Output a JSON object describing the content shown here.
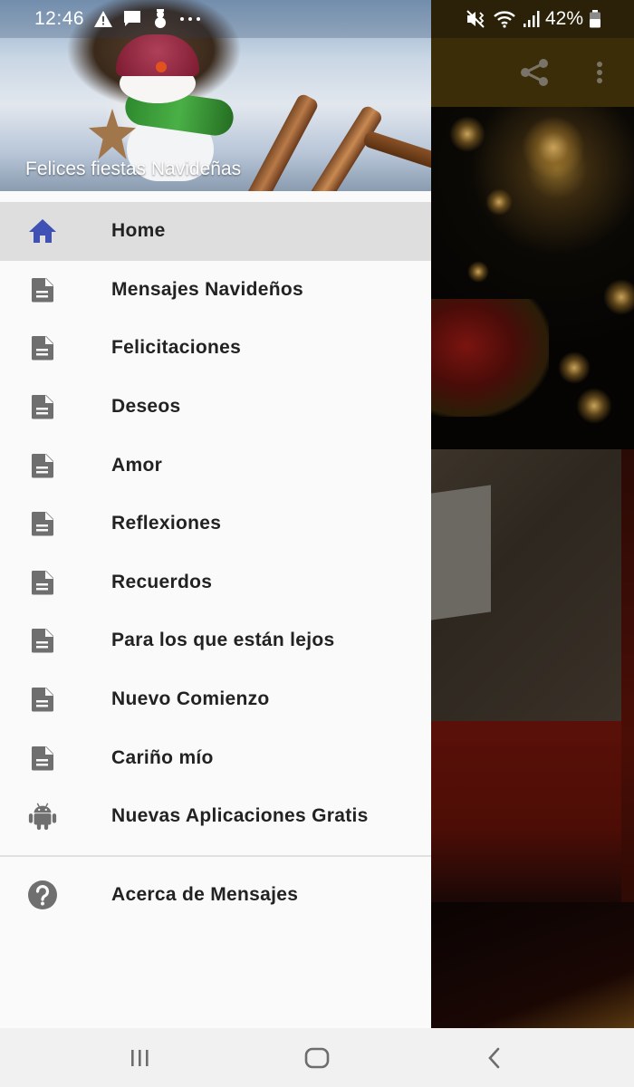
{
  "status_bar": {
    "time": "12:46",
    "left_icons": [
      "warning-icon",
      "message-icon",
      "snowman-notification-icon",
      "more-notifications-icon"
    ],
    "right_icons": [
      "vibrate-mute-icon",
      "wifi-icon",
      "signal-icon",
      "battery-icon"
    ],
    "battery": "42%"
  },
  "app_toolbar": {
    "actions": [
      "share-icon",
      "overflow-menu-icon"
    ]
  },
  "drawer": {
    "header_title": "Felices fiestas Navideñas",
    "items": [
      {
        "label": "Home",
        "icon": "home-icon",
        "active": true,
        "icon_color": "#3f51b5"
      },
      {
        "label": "Mensajes Navideños",
        "icon": "document-icon"
      },
      {
        "label": "Felicitaciones",
        "icon": "document-icon"
      },
      {
        "label": "Deseos",
        "icon": "document-icon"
      },
      {
        "label": "Amor",
        "icon": "document-icon"
      },
      {
        "label": "Reflexiones",
        "icon": "document-icon"
      },
      {
        "label": "Recuerdos",
        "icon": "document-icon"
      },
      {
        "label": "Para los que están lejos",
        "icon": "document-icon"
      },
      {
        "label": "Nuevo Comienzo",
        "icon": "document-icon"
      },
      {
        "label": "Cariño mío",
        "icon": "document-icon"
      },
      {
        "label": "Nuevas Aplicaciones Gratis",
        "icon": "android-icon"
      }
    ],
    "secondary_items": [
      {
        "label": "Acerca de Mensajes",
        "icon": "help-icon"
      }
    ]
  },
  "nav_bar": {
    "buttons": [
      "recent-apps-icon",
      "home-nav-icon",
      "back-icon"
    ]
  },
  "colors": {
    "accent": "#3f51b5",
    "icon_gray": "#6f6f6f",
    "active_row": "#dedede",
    "drawer_bg": "#fafafa",
    "toolbar_bg": "#3a2d08"
  }
}
